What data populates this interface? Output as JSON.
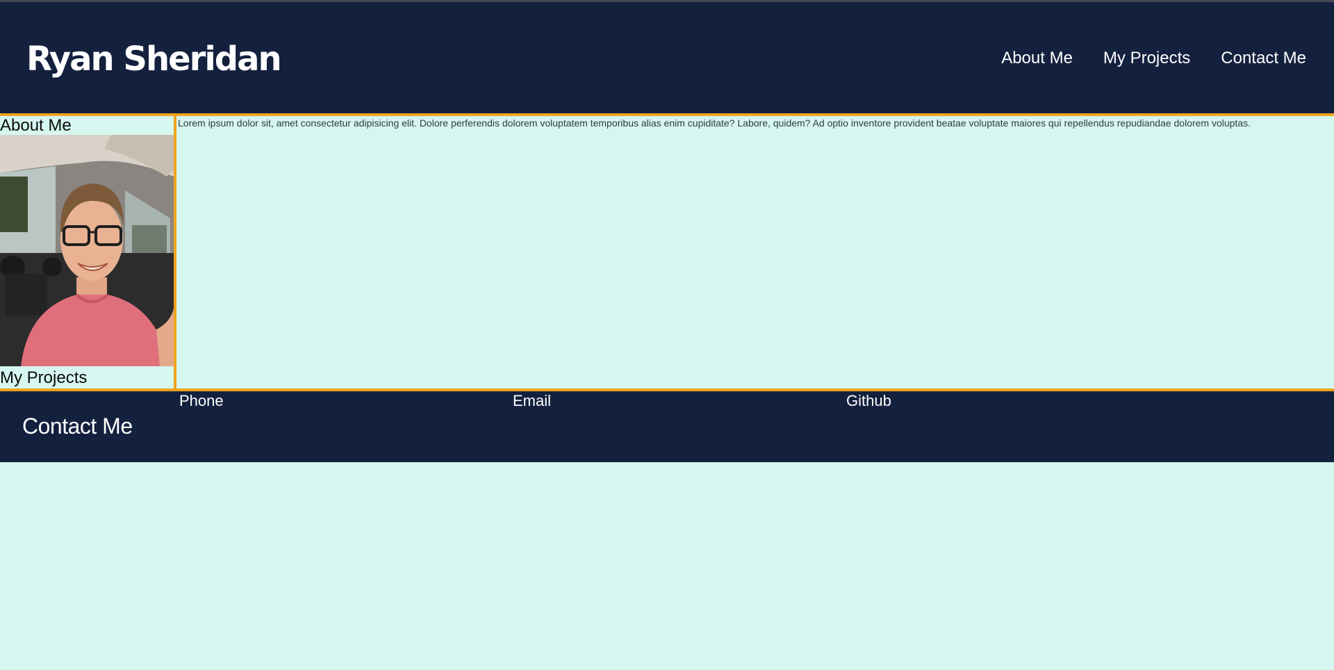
{
  "header": {
    "title": "Ryan Sheridan",
    "nav": [
      "About Me",
      "My Projects",
      "Contact Me"
    ]
  },
  "sidebar": {
    "about_label": "About Me",
    "projects_label": "My Projects",
    "photo_alt": "Photo of Ryan Sheridan"
  },
  "main": {
    "paragraph": "Lorem ipsum dolor sit, amet consectetur adipisicing elit. Dolore perferendis dolorem voluptatem temporibus alias enim cupiditate? Labore, quidem? Ad optio inventore provident beatae voluptate maiores qui repellendus repudiandae dolorem voluptas."
  },
  "footer": {
    "title": "Contact Me",
    "items": [
      "Phone",
      "Email",
      "Github"
    ]
  },
  "colors": {
    "navy": "#14213e",
    "accent_orange": "#f0a41b",
    "mint_background": "#d6f7ef",
    "text_light": "#ffffff"
  }
}
